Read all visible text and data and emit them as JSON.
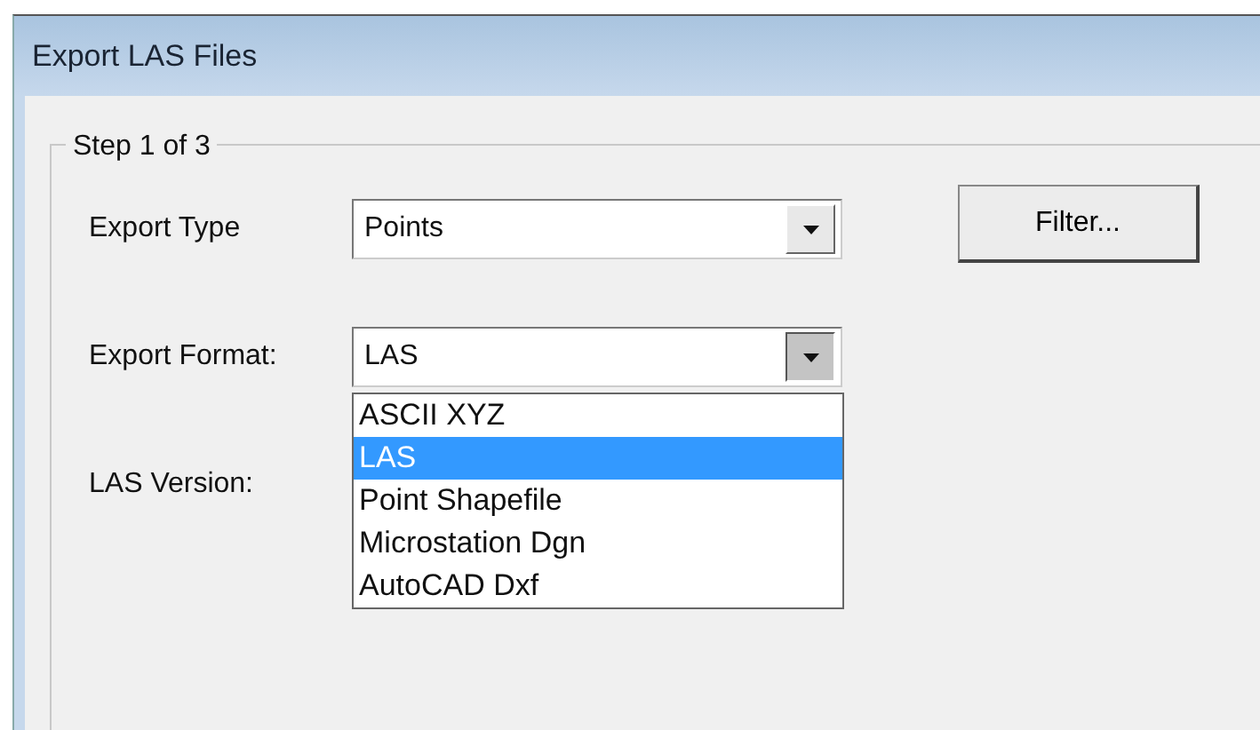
{
  "window": {
    "title": "Export LAS Files"
  },
  "group": {
    "legend": "Step 1 of 3"
  },
  "fields": [
    {
      "label": "Export Type",
      "value": "Points",
      "expanded": false
    },
    {
      "label": "Export Format:",
      "value": "LAS",
      "expanded": true,
      "options": [
        {
          "label": "ASCII XYZ",
          "selected": false
        },
        {
          "label": "LAS",
          "selected": true
        },
        {
          "label": "Point Shapefile",
          "selected": false
        },
        {
          "label": "Microstation Dgn",
          "selected": false
        },
        {
          "label": "AutoCAD Dxf",
          "selected": false
        }
      ]
    },
    {
      "label": "LAS Version:"
    }
  ],
  "filter_button": "Filter..."
}
